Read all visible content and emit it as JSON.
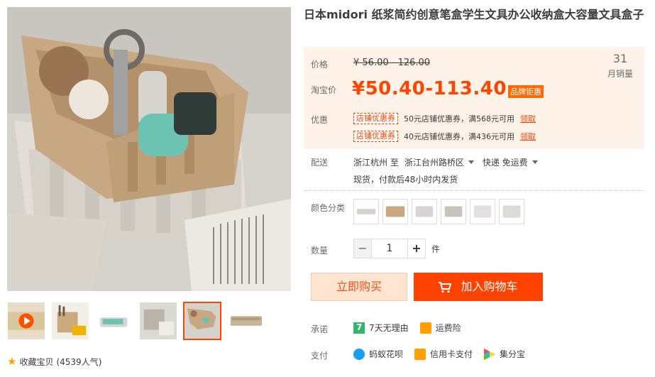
{
  "product": {
    "title": "日本midori 纸浆简约创意笔盒学生文具办公收纳盒大容量文具盒子"
  },
  "price": {
    "label": "价格",
    "original": "¥ 56.00 - 126.00",
    "tb_label": "淘宝价",
    "current": "¥50.40-113.40",
    "brand_badge": "品牌钜惠",
    "sales_count": "31",
    "sales_label": "月销量"
  },
  "coupons": {
    "label": "优惠",
    "items": [
      {
        "tag": "店铺优惠券",
        "text": "50元店铺优惠券，满568元可用",
        "action": "领取"
      },
      {
        "tag": "店铺优惠券",
        "text": "40元店铺优惠券，满436元可用",
        "action": "领取"
      }
    ]
  },
  "delivery": {
    "label": "配送",
    "from": "浙江杭州 至",
    "to": "浙江台州路桥区",
    "method": "快递 免运费",
    "note": "现货，付款后48小时内发货"
  },
  "color": {
    "label": "颜色分类",
    "count_options": 6
  },
  "quantity": {
    "label": "数量",
    "value": "1",
    "minus": "−",
    "plus": "+",
    "unit": "件"
  },
  "actions": {
    "buy_now": "立即购买",
    "add_cart": "加入购物车"
  },
  "promise": {
    "label": "承诺",
    "items": [
      "7天无理由",
      "运费险"
    ]
  },
  "payment": {
    "label": "支付",
    "items": [
      "蚂蚁花呗",
      "信用卡支付",
      "集分宝"
    ]
  },
  "favorite": {
    "text": "收藏宝贝",
    "count": "(4539人气)"
  },
  "colors": {
    "accent": "#ff4400",
    "panel_bg": "#fff2e8",
    "buy_bg": "#ffe4d0",
    "cart_bg": "#ff4200"
  }
}
